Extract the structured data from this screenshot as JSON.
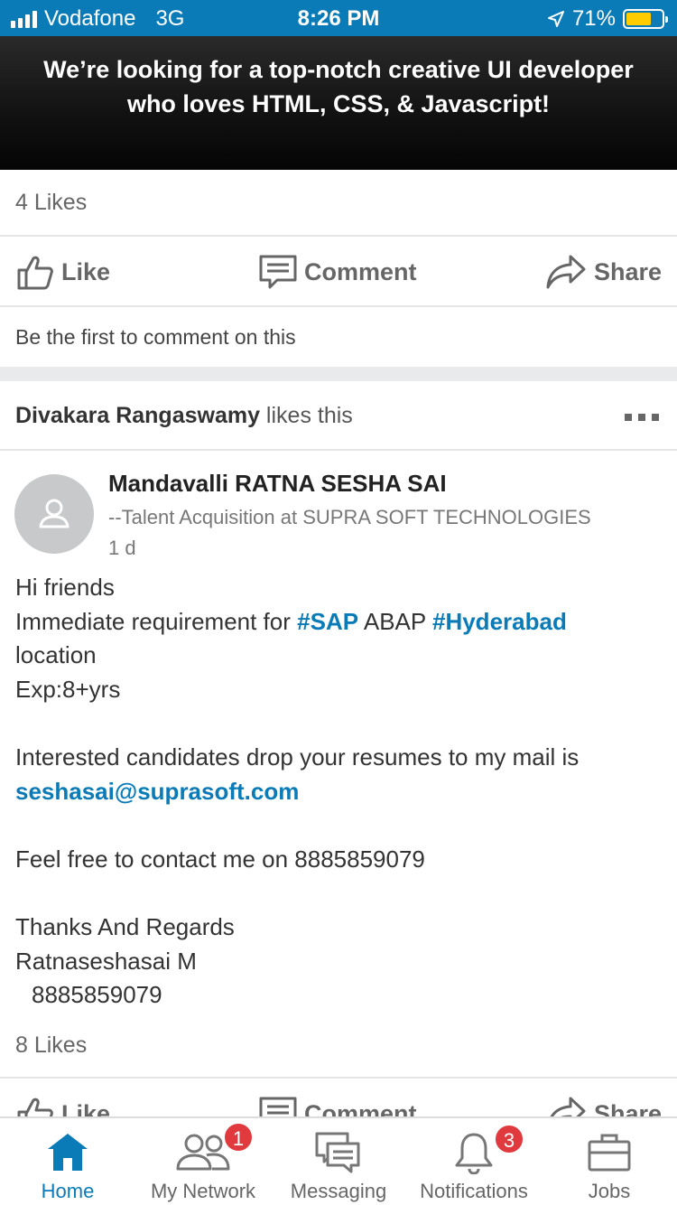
{
  "status_bar": {
    "carrier": "Vodafone",
    "network": "3G",
    "time": "8:26 PM",
    "battery": "71%",
    "battery_level": 0.71,
    "battery_color": "#ffcc00"
  },
  "banner": {
    "line1": "We’re looking for a top-notch creative UI developer",
    "line2": "who loves HTML, CSS, & Javascript!"
  },
  "post1": {
    "likes": "4 Likes",
    "actions": {
      "like": "Like",
      "comment": "Comment",
      "share": "Share"
    },
    "comment_prompt": "Be the first to comment on this"
  },
  "post2": {
    "liker_name": "Divakara Rangaswamy",
    "liker_text": " likes this",
    "author": "Mandavalli RATNA SESHA SAI",
    "author_title": "--Talent Acquisition at SUPRA SOFT TECHNOLOGIES",
    "time": "1 d",
    "body": {
      "l1": "Hi friends",
      "l2a": "Immediate  requirement for ",
      "tag1": "#SAP",
      "l2b": " ABAP ",
      "tag2": "#Hyderabad",
      "l3": "location",
      "l4": "Exp:8+yrs",
      "l5": "Interested candidates drop your resumes to my mail is",
      "email": "seshasai@suprasoft.com",
      "l6": "Feel free to contact me on 8885859079",
      "l7": "Thanks And Regards",
      "l8": "Ratnaseshasai M",
      "l9": "8885859079"
    },
    "likes": "8 Likes",
    "actions": {
      "like": "Like",
      "comment": "Comment",
      "share": "Share"
    }
  },
  "nav": {
    "items": [
      {
        "label": "Home",
        "icon": "home-icon",
        "active": true
      },
      {
        "label": "My Network",
        "icon": "network-icon",
        "badge": "1"
      },
      {
        "label": "Messaging",
        "icon": "messaging-icon"
      },
      {
        "label": "Notifications",
        "icon": "bell-icon",
        "badge": "3"
      },
      {
        "label": "Jobs",
        "icon": "briefcase-icon"
      }
    ]
  },
  "colors": {
    "accent": "#0b7bb8",
    "badge": "#e0393e",
    "status_bar": "#0b7bb8"
  }
}
